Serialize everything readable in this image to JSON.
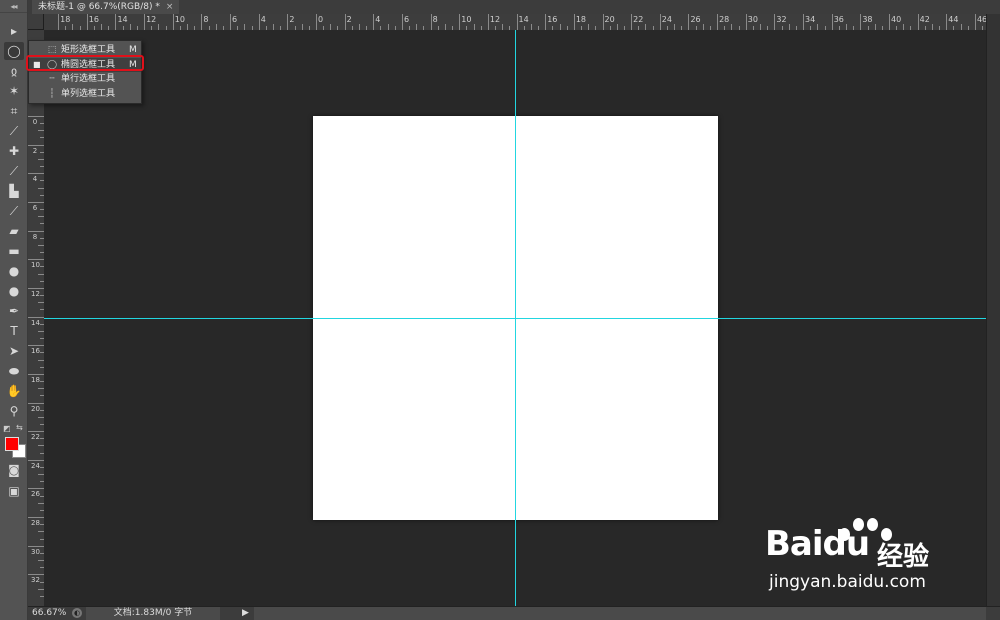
{
  "document_tab": {
    "title": "未标题-1 @ 66.7%(RGB/8) *",
    "close": "×"
  },
  "toolbar": {
    "grip": "◂◂",
    "tools": [
      {
        "name": "move-tool-icon",
        "glyph": "▸"
      },
      {
        "name": "elliptical-marquee-tool-icon",
        "glyph": "◯",
        "active": true
      },
      {
        "name": "lasso-tool-icon",
        "glyph": "ჲ"
      },
      {
        "name": "magic-wand-tool-icon",
        "glyph": "✶"
      },
      {
        "name": "crop-tool-icon",
        "glyph": "⌗"
      },
      {
        "name": "eyedropper-tool-icon",
        "glyph": "⟋"
      },
      {
        "name": "spot-healing-brush-icon",
        "glyph": "✚"
      },
      {
        "name": "brush-tool-icon",
        "glyph": "⟋"
      },
      {
        "name": "clone-stamp-tool-icon",
        "glyph": "▙"
      },
      {
        "name": "history-brush-icon",
        "glyph": "⟋"
      },
      {
        "name": "eraser-tool-icon",
        "glyph": "▰"
      },
      {
        "name": "gradient-tool-icon",
        "glyph": "▬"
      },
      {
        "name": "blur-tool-icon",
        "glyph": "●"
      },
      {
        "name": "dodge-tool-icon",
        "glyph": "●"
      },
      {
        "name": "pen-tool-icon",
        "glyph": "✒"
      },
      {
        "name": "type-tool-icon",
        "glyph": "T"
      },
      {
        "name": "path-selection-tool-icon",
        "glyph": "➤"
      },
      {
        "name": "ellipse-shape-tool-icon",
        "glyph": "⬬"
      },
      {
        "name": "hand-tool-icon",
        "glyph": "✋"
      },
      {
        "name": "zoom-tool-icon",
        "glyph": "⚲"
      }
    ],
    "default_colors_glyph": "◩",
    "swap_colors_glyph": "⇆",
    "quick_mask_glyph": "◙",
    "screen_mode_glyph": "▣",
    "foreground_color": "#ff0000",
    "background_color": "#ffffff"
  },
  "flyout": {
    "items": [
      {
        "icon": "⬚",
        "label": "矩形选框工具",
        "shortcut": "M",
        "selected": false,
        "marker": ""
      },
      {
        "icon": "◯",
        "label": "椭圆选框工具",
        "shortcut": "M",
        "selected": true,
        "marker": "■"
      },
      {
        "icon": "╌",
        "label": "单行选框工具",
        "shortcut": "",
        "selected": false,
        "marker": ""
      },
      {
        "icon": "┆",
        "label": "单列选框工具",
        "shortcut": "",
        "selected": false,
        "marker": ""
      }
    ]
  },
  "rulers": {
    "horizontal_labels": [
      "18",
      "16",
      "14",
      "12",
      "10",
      "8",
      "6",
      "4",
      "2",
      "0",
      "2",
      "4",
      "6",
      "8",
      "10",
      "12",
      "14",
      "16",
      "18",
      "20",
      "22",
      "24",
      "26",
      "28",
      "30",
      "32",
      "34",
      "36",
      "38",
      "40",
      "42",
      "44",
      "46"
    ],
    "vertical_labels": [
      "0",
      "2",
      "4",
      "6",
      "8",
      "10",
      "12",
      "14",
      "16",
      "18",
      "20",
      "22",
      "24",
      "26",
      "28",
      "30",
      "32"
    ]
  },
  "status": {
    "zoom": "66.67%",
    "info_icon": "◐",
    "doc_info": "文档:1.83M/0 字节",
    "arrow": "▶"
  },
  "watermark": {
    "logo": "Bai",
    "logo_du": "du",
    "chinese": "经验",
    "url": "jingyan.baidu.com"
  },
  "colors": {
    "guide": "#22d6e0",
    "highlight": "#e0101a",
    "canvas": "#282828",
    "panel": "#535353"
  }
}
